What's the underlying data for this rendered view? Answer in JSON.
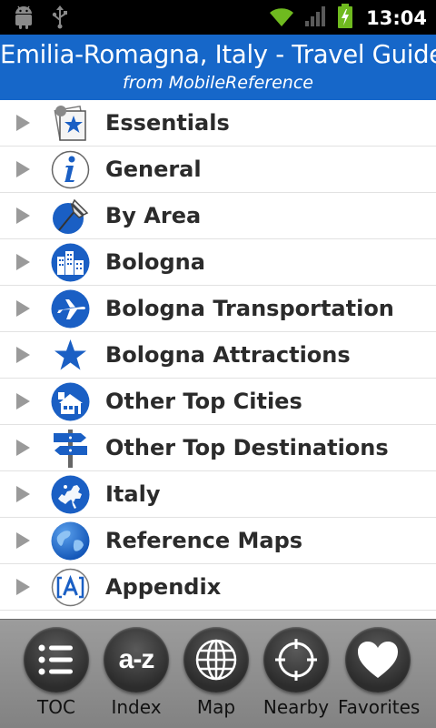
{
  "status_bar": {
    "time": "13:04",
    "icons": [
      "android-icon",
      "usb-icon",
      "wifi-icon",
      "signal-icon",
      "battery-charging-icon"
    ]
  },
  "header": {
    "title": "Emilia-Romagna, Italy - Travel Guide",
    "subtitle": "from MobileReference",
    "background_color": "#1667c9"
  },
  "toc": {
    "items": [
      {
        "label": "Essentials",
        "icon": "essentials-icon"
      },
      {
        "label": "General",
        "icon": "info-icon"
      },
      {
        "label": "By Area",
        "icon": "pushpin-icon"
      },
      {
        "label": "Bologna",
        "icon": "city-buildings-icon"
      },
      {
        "label": "Bologna Transportation",
        "icon": "airplane-icon"
      },
      {
        "label": "Bologna Attractions",
        "icon": "star-icon"
      },
      {
        "label": "Other Top Cities",
        "icon": "house-icon"
      },
      {
        "label": "Other Top Destinations",
        "icon": "signpost-icon"
      },
      {
        "label": "Italy",
        "icon": "europe-map-icon"
      },
      {
        "label": "Reference Maps",
        "icon": "globe-icon"
      },
      {
        "label": "Appendix",
        "icon": "appendix-bracket-icon"
      }
    ]
  },
  "toolbar": {
    "items": [
      {
        "label": "TOC",
        "icon": "list-icon"
      },
      {
        "label": "Index",
        "icon": "a-z-icon",
        "icon_text": "a-z"
      },
      {
        "label": "Map",
        "icon": "globe-grid-icon"
      },
      {
        "label": "Nearby",
        "icon": "crosshair-icon"
      },
      {
        "label": "Favorites",
        "icon": "heart-icon"
      }
    ]
  }
}
